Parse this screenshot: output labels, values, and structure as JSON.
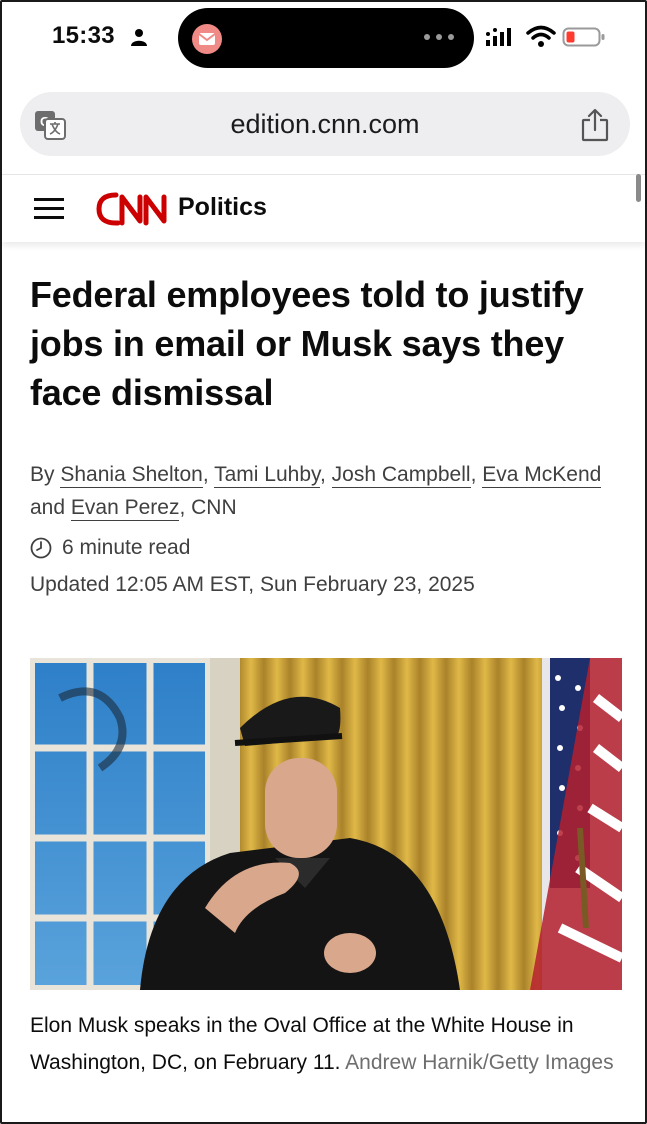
{
  "status_bar": {
    "time": "15:33",
    "person_icon": "person-icon",
    "island_app_icon": "mail-app-icon",
    "signal_icon": "cellular-signal-icon",
    "wifi_icon": "wifi-icon",
    "battery_icon": "battery-low-icon",
    "battery_color": "#ff3b30"
  },
  "browser": {
    "url": "edition.cnn.com",
    "translate_icon": "translate-icon",
    "share_icon": "share-icon"
  },
  "header": {
    "menu_icon": "hamburger-menu-icon",
    "logo_text": "CNN",
    "logo_color": "#cc0000",
    "section": "Politics"
  },
  "article": {
    "headline": "Federal employees told to justify jobs in email or Musk says they face dismissal",
    "byline": {
      "prefix": "By",
      "authors": [
        "Shania Shelton",
        "Tami Luhby",
        "Josh Campbell",
        "Eva McKend",
        "Evan Perez"
      ],
      "separator": ",",
      "conjunction": "and",
      "suffix": ", CNN"
    },
    "read_time": "6 minute read",
    "updated": "Updated 12:05 AM EST, Sun February 23, 2025",
    "image": {
      "caption": "Elon Musk speaks in the Oval Office at the White House in Washington, DC, on February 11.",
      "credit": "Andrew Harnik/Getty Images"
    }
  }
}
